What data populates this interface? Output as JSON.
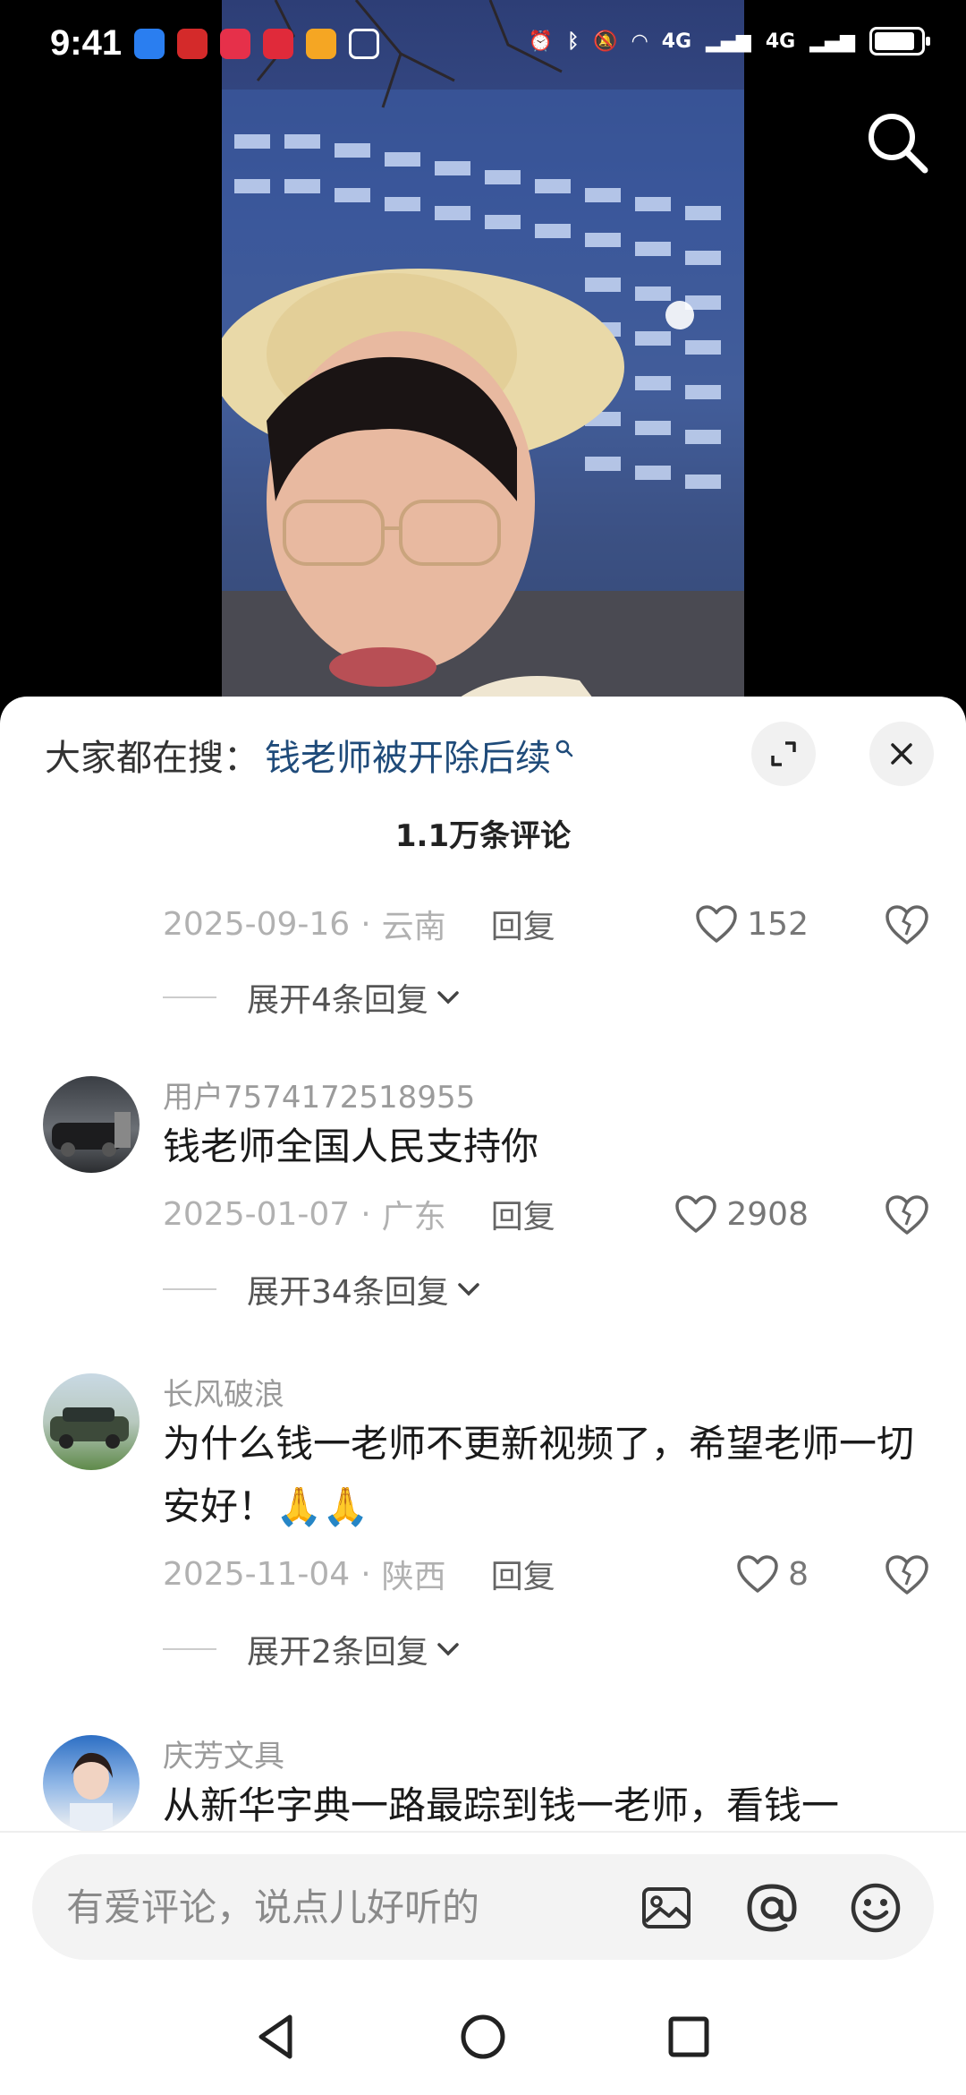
{
  "status_bar": {
    "time": "9:41",
    "network_1": "4G",
    "network_2": "4G"
  },
  "header": {
    "hot_search_label": "大家都在搜：",
    "hot_search_term": "钱老师被开除后续",
    "comment_count": "1.1万条评论"
  },
  "comments": [
    {
      "username": "",
      "text": "",
      "date": "2025-09-16",
      "location": "云南",
      "reply_label": "回复",
      "likes": "152",
      "expand_label": "展开4条回复"
    },
    {
      "username": "用户7574172518955",
      "text": "钱老师全国人民支持你",
      "date": "2025-01-07",
      "location": "广东",
      "reply_label": "回复",
      "likes": "2908",
      "expand_label": "展开34条回复"
    },
    {
      "username": "长风破浪",
      "text": "为什么钱一老师不更新视频了，希望老师一切安好！🙏🙏",
      "date": "2025-11-04",
      "location": "陕西",
      "reply_label": "回复",
      "likes": "8",
      "expand_label": "展开2条回复"
    },
    {
      "username": "庆芳文具",
      "text": "从新华字典一路最踪到钱一老师，看钱一"
    }
  ],
  "input": {
    "placeholder": "有爱评论，说点儿好听的"
  },
  "icons": {
    "search": "search-icon",
    "expand": "expand-icon",
    "close": "close-icon",
    "like": "heart-icon",
    "dislike": "broken-heart-icon",
    "image": "image-icon",
    "mention": "at-icon",
    "emoji": "emoji-icon"
  },
  "colors": {
    "hot_term": "#1f4b7a",
    "meta_gray": "#b1b1b1",
    "sheet_bg": "#ffffff"
  }
}
